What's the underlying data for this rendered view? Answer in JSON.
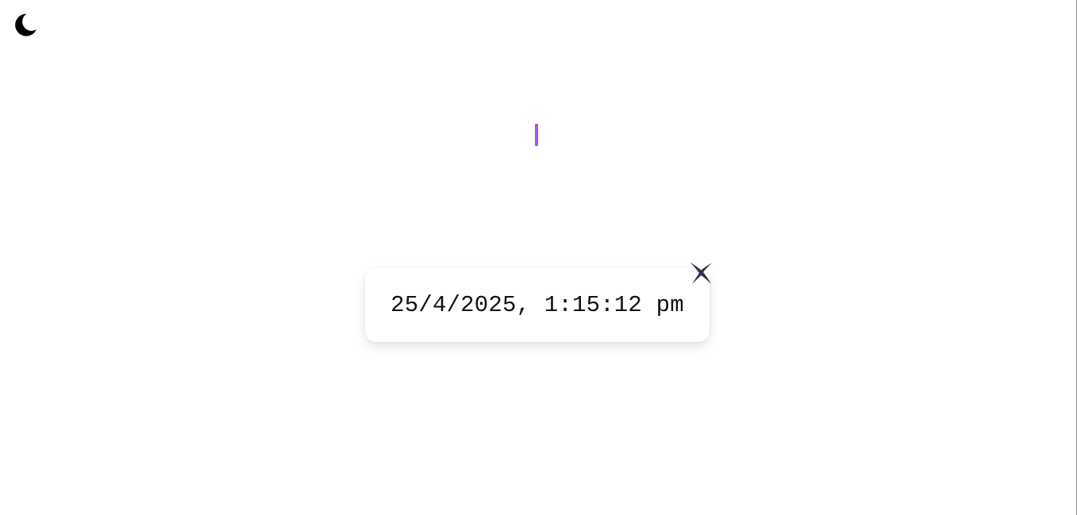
{
  "theme_toggle": {
    "icon": "moon-icon",
    "color": "#000000"
  },
  "text_cursor": {
    "color": "#a855d9"
  },
  "clock": {
    "datetime_text": "25/4/2025, 1:15:12 pm",
    "text_color": "#111111"
  },
  "close_button": {
    "icon": "close-x-icon",
    "color": "#2c3648"
  }
}
